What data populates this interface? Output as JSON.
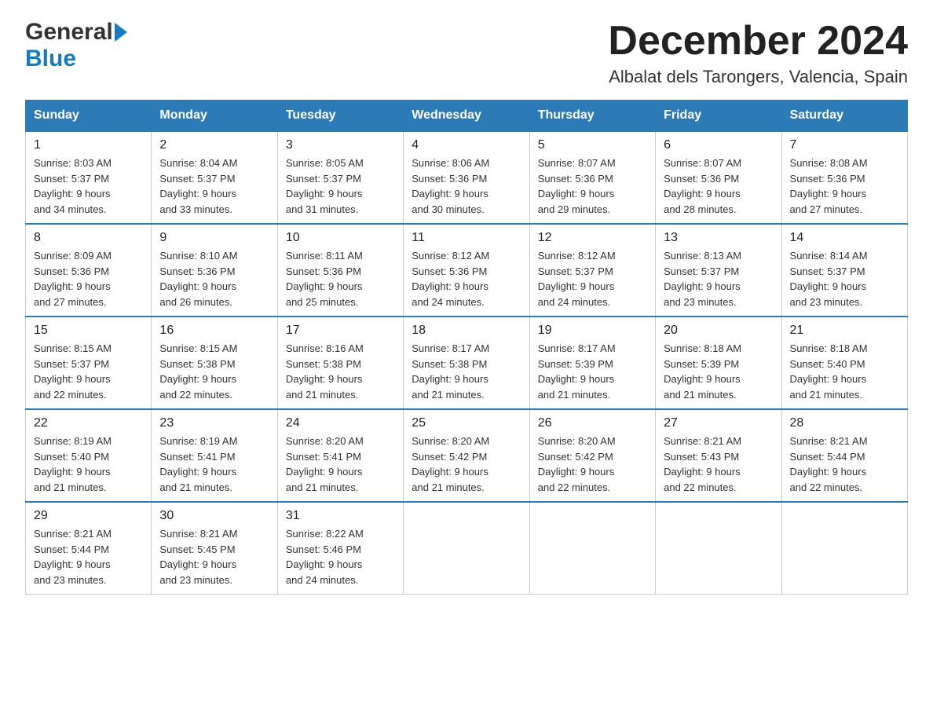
{
  "header": {
    "title": "December 2024",
    "subtitle": "Albalat dels Tarongers, Valencia, Spain",
    "logo_general": "General",
    "logo_blue": "Blue"
  },
  "weekdays": [
    "Sunday",
    "Monday",
    "Tuesday",
    "Wednesday",
    "Thursday",
    "Friday",
    "Saturday"
  ],
  "weeks": [
    [
      {
        "day": "1",
        "sunrise": "8:03 AM",
        "sunset": "5:37 PM",
        "daylight": "9 hours and 34 minutes."
      },
      {
        "day": "2",
        "sunrise": "8:04 AM",
        "sunset": "5:37 PM",
        "daylight": "9 hours and 33 minutes."
      },
      {
        "day": "3",
        "sunrise": "8:05 AM",
        "sunset": "5:37 PM",
        "daylight": "9 hours and 31 minutes."
      },
      {
        "day": "4",
        "sunrise": "8:06 AM",
        "sunset": "5:36 PM",
        "daylight": "9 hours and 30 minutes."
      },
      {
        "day": "5",
        "sunrise": "8:07 AM",
        "sunset": "5:36 PM",
        "daylight": "9 hours and 29 minutes."
      },
      {
        "day": "6",
        "sunrise": "8:07 AM",
        "sunset": "5:36 PM",
        "daylight": "9 hours and 28 minutes."
      },
      {
        "day": "7",
        "sunrise": "8:08 AM",
        "sunset": "5:36 PM",
        "daylight": "9 hours and 27 minutes."
      }
    ],
    [
      {
        "day": "8",
        "sunrise": "8:09 AM",
        "sunset": "5:36 PM",
        "daylight": "9 hours and 27 minutes."
      },
      {
        "day": "9",
        "sunrise": "8:10 AM",
        "sunset": "5:36 PM",
        "daylight": "9 hours and 26 minutes."
      },
      {
        "day": "10",
        "sunrise": "8:11 AM",
        "sunset": "5:36 PM",
        "daylight": "9 hours and 25 minutes."
      },
      {
        "day": "11",
        "sunrise": "8:12 AM",
        "sunset": "5:36 PM",
        "daylight": "9 hours and 24 minutes."
      },
      {
        "day": "12",
        "sunrise": "8:12 AM",
        "sunset": "5:37 PM",
        "daylight": "9 hours and 24 minutes."
      },
      {
        "day": "13",
        "sunrise": "8:13 AM",
        "sunset": "5:37 PM",
        "daylight": "9 hours and 23 minutes."
      },
      {
        "day": "14",
        "sunrise": "8:14 AM",
        "sunset": "5:37 PM",
        "daylight": "9 hours and 23 minutes."
      }
    ],
    [
      {
        "day": "15",
        "sunrise": "8:15 AM",
        "sunset": "5:37 PM",
        "daylight": "9 hours and 22 minutes."
      },
      {
        "day": "16",
        "sunrise": "8:15 AM",
        "sunset": "5:38 PM",
        "daylight": "9 hours and 22 minutes."
      },
      {
        "day": "17",
        "sunrise": "8:16 AM",
        "sunset": "5:38 PM",
        "daylight": "9 hours and 21 minutes."
      },
      {
        "day": "18",
        "sunrise": "8:17 AM",
        "sunset": "5:38 PM",
        "daylight": "9 hours and 21 minutes."
      },
      {
        "day": "19",
        "sunrise": "8:17 AM",
        "sunset": "5:39 PM",
        "daylight": "9 hours and 21 minutes."
      },
      {
        "day": "20",
        "sunrise": "8:18 AM",
        "sunset": "5:39 PM",
        "daylight": "9 hours and 21 minutes."
      },
      {
        "day": "21",
        "sunrise": "8:18 AM",
        "sunset": "5:40 PM",
        "daylight": "9 hours and 21 minutes."
      }
    ],
    [
      {
        "day": "22",
        "sunrise": "8:19 AM",
        "sunset": "5:40 PM",
        "daylight": "9 hours and 21 minutes."
      },
      {
        "day": "23",
        "sunrise": "8:19 AM",
        "sunset": "5:41 PM",
        "daylight": "9 hours and 21 minutes."
      },
      {
        "day": "24",
        "sunrise": "8:20 AM",
        "sunset": "5:41 PM",
        "daylight": "9 hours and 21 minutes."
      },
      {
        "day": "25",
        "sunrise": "8:20 AM",
        "sunset": "5:42 PM",
        "daylight": "9 hours and 21 minutes."
      },
      {
        "day": "26",
        "sunrise": "8:20 AM",
        "sunset": "5:42 PM",
        "daylight": "9 hours and 22 minutes."
      },
      {
        "day": "27",
        "sunrise": "8:21 AM",
        "sunset": "5:43 PM",
        "daylight": "9 hours and 22 minutes."
      },
      {
        "day": "28",
        "sunrise": "8:21 AM",
        "sunset": "5:44 PM",
        "daylight": "9 hours and 22 minutes."
      }
    ],
    [
      {
        "day": "29",
        "sunrise": "8:21 AM",
        "sunset": "5:44 PM",
        "daylight": "9 hours and 23 minutes."
      },
      {
        "day": "30",
        "sunrise": "8:21 AM",
        "sunset": "5:45 PM",
        "daylight": "9 hours and 23 minutes."
      },
      {
        "day": "31",
        "sunrise": "8:22 AM",
        "sunset": "5:46 PM",
        "daylight": "9 hours and 24 minutes."
      },
      null,
      null,
      null,
      null
    ]
  ],
  "labels": {
    "sunrise": "Sunrise:",
    "sunset": "Sunset:",
    "daylight": "Daylight:"
  }
}
